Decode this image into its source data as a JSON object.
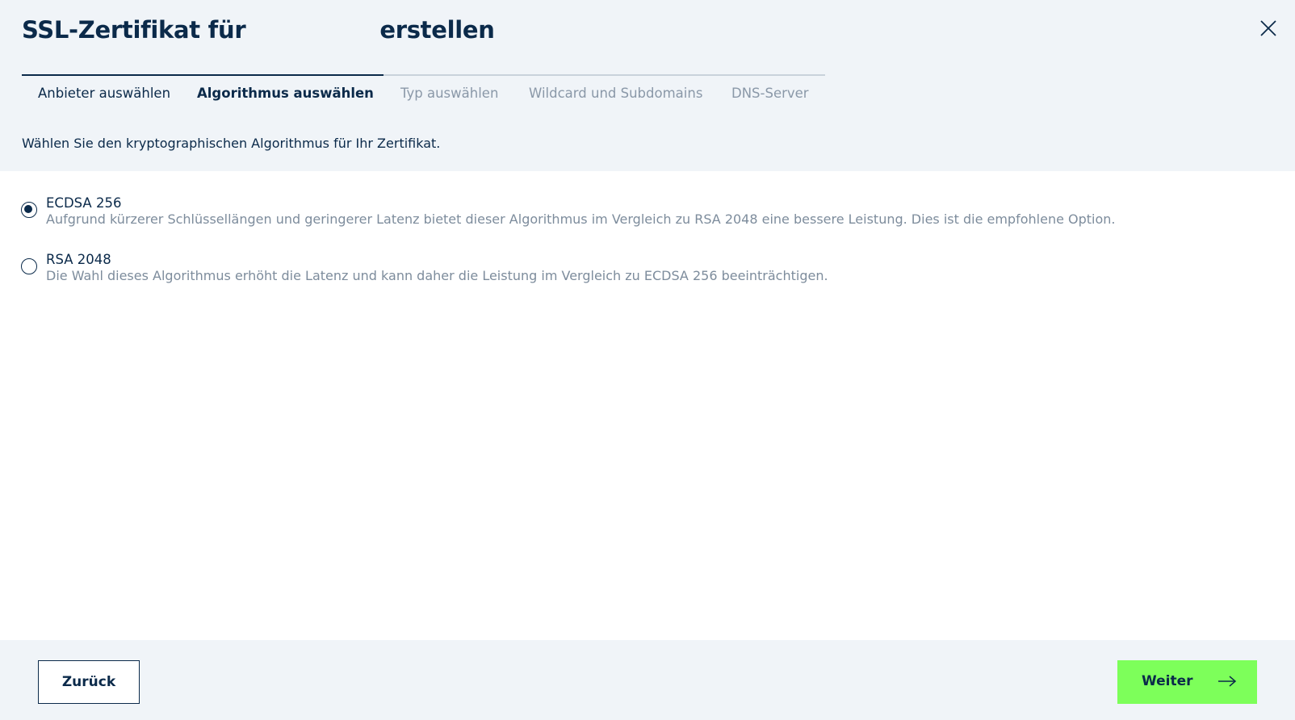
{
  "header": {
    "title_before": "SSL-Zertifikat für",
    "title_after": "erstellen"
  },
  "steps": [
    {
      "label": "Anbieter auswählen",
      "state": "done"
    },
    {
      "label": "Algorithmus auswählen",
      "state": "active"
    },
    {
      "label": "Typ auswählen",
      "state": "todo"
    },
    {
      "label": "Wildcard und Subdomains",
      "state": "todo"
    },
    {
      "label": "DNS-Server",
      "state": "todo"
    }
  ],
  "intro": "Wählen Sie den kryptographischen Algorithmus für Ihr Zertifikat.",
  "options": [
    {
      "title": "ECDSA 256",
      "description": "Aufgrund kürzerer Schlüssellängen und geringerer Latenz bietet dieser Algorithmus im Vergleich zu RSA 2048 eine bessere Leistung. Dies ist die empfohlene Option.",
      "selected": true
    },
    {
      "title": "RSA 2048",
      "description": "Die Wahl dieses Algorithmus erhöht die Latenz und kann daher die Leistung im Vergleich zu ECDSA 256 beeinträchtigen.",
      "selected": false
    }
  ],
  "footer": {
    "back_label": "Zurück",
    "next_label": "Weiter"
  },
  "icons": {
    "close": "close-icon",
    "next_arrow": "arrow-right-icon"
  },
  "colors": {
    "primary": "#0b2a4a",
    "accent": "#7dff5a",
    "panel_bg": "#f0f4f8",
    "muted_text": "#7d8c9c"
  }
}
